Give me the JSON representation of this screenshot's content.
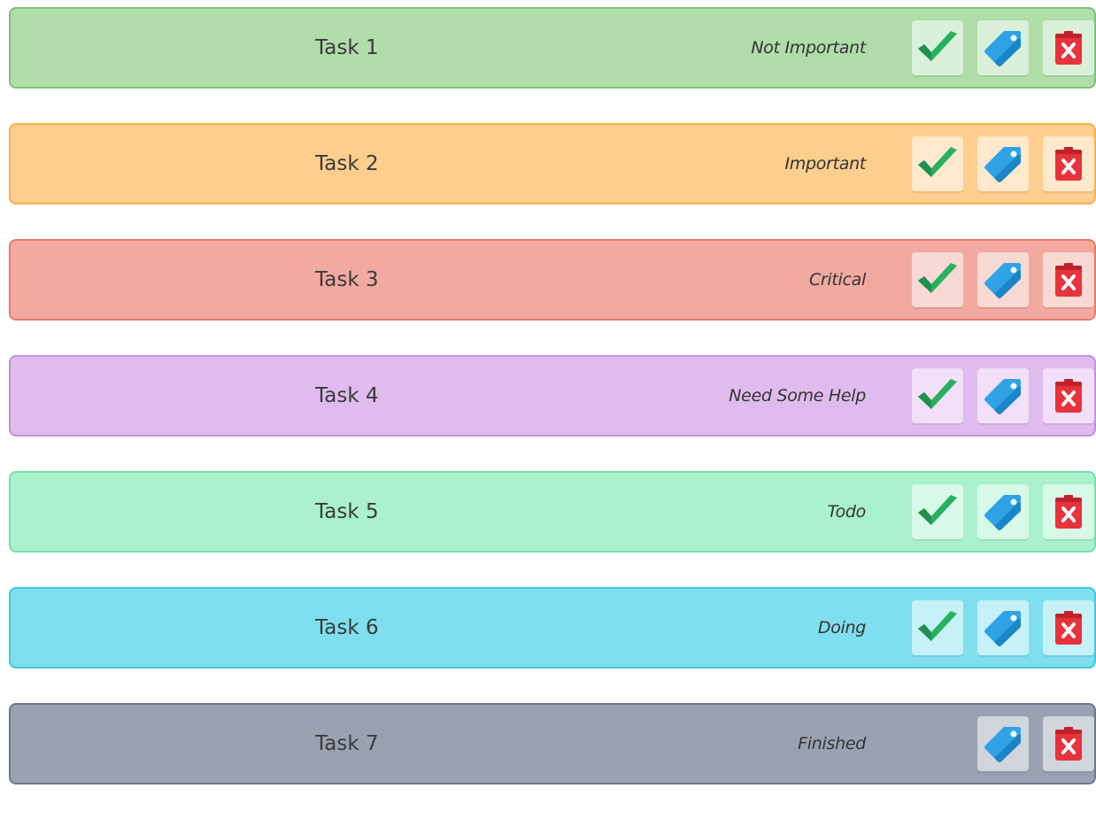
{
  "tasks": [
    {
      "name": "Task 1",
      "status": "Not Important",
      "bg": "#b0ddaa",
      "border": "#7cc27a",
      "show_done": true
    },
    {
      "name": "Task 2",
      "status": "Important",
      "bg": "#fdce8e",
      "border": "#f5b14e",
      "show_done": true
    },
    {
      "name": "Task 3",
      "status": "Critical",
      "bg": "#f2aaa0",
      "border": "#ea7868",
      "show_done": true
    },
    {
      "name": "Task 4",
      "status": "Need Some Help",
      "bg": "#e0bbee",
      "border": "#c58fdc",
      "show_done": true
    },
    {
      "name": "Task 5",
      "status": "Todo",
      "bg": "#a9f2cd",
      "border": "#76e0a8",
      "show_done": true
    },
    {
      "name": "Task 6",
      "status": "Doing",
      "bg": "#7fdfee",
      "border": "#3fc9e0",
      "show_done": true
    },
    {
      "name": "Task 7",
      "status": "Finished",
      "bg": "#9aa2b2",
      "border": "#6f7888",
      "show_done": false
    }
  ],
  "icons": {
    "done": "check-icon",
    "tag": "tag-icon",
    "delete": "delete-clipboard-icon"
  },
  "colors": {
    "check": "#27b062",
    "check_dark": "#1f9050",
    "tag": "#2fa3e6",
    "tag_dark": "#1b86c7",
    "delete": "#e8323c",
    "delete_dark": "#c0222b"
  }
}
